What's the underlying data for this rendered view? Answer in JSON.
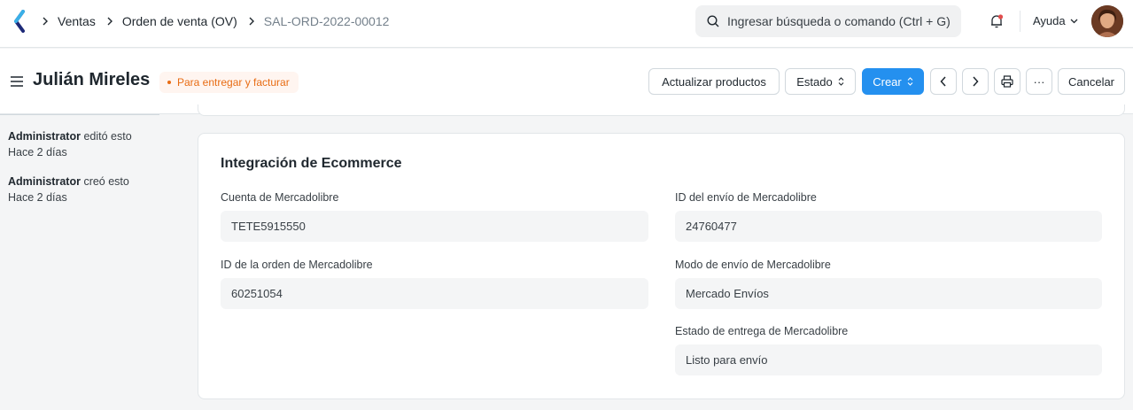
{
  "navbar": {
    "breadcrumbs": [
      "Ventas",
      "Orden de venta (OV)",
      "SAL-ORD-2022-00012"
    ],
    "search_placeholder": "Ingresar búsqueda o comando (Ctrl + G)",
    "help_label": "Ayuda"
  },
  "page": {
    "title": "Julián Mireles",
    "status": "Para entregar y facturar",
    "buttons": {
      "update_items": "Actualizar productos",
      "status": "Estado",
      "create": "Crear",
      "more": "···",
      "cancel": "Cancelar"
    }
  },
  "timeline": [
    {
      "user": "Administrator",
      "action": "editó esto",
      "time": "Hace 2 días"
    },
    {
      "user": "Administrator",
      "action": "creó esto",
      "time": "Hace 2 días"
    }
  ],
  "section": {
    "title": "Integración de Ecommerce",
    "fields": {
      "account": {
        "label": "Cuenta de Mercadolibre",
        "value": "TETE5915550"
      },
      "order_id": {
        "label": "ID de la orden de Mercadolibre",
        "value": "60251054"
      },
      "shipment_id": {
        "label": "ID del envío de Mercadolibre",
        "value": "24760477"
      },
      "shipping_mode": {
        "label": "Modo de envío de Mercadolibre",
        "value": "Mercado Envíos"
      },
      "delivery_status": {
        "label": "Estado de entrega de Mercadolibre",
        "value": "Listo para envío"
      }
    }
  },
  "colors": {
    "accent": "#2490ef",
    "status_orange": "#e86c13"
  }
}
